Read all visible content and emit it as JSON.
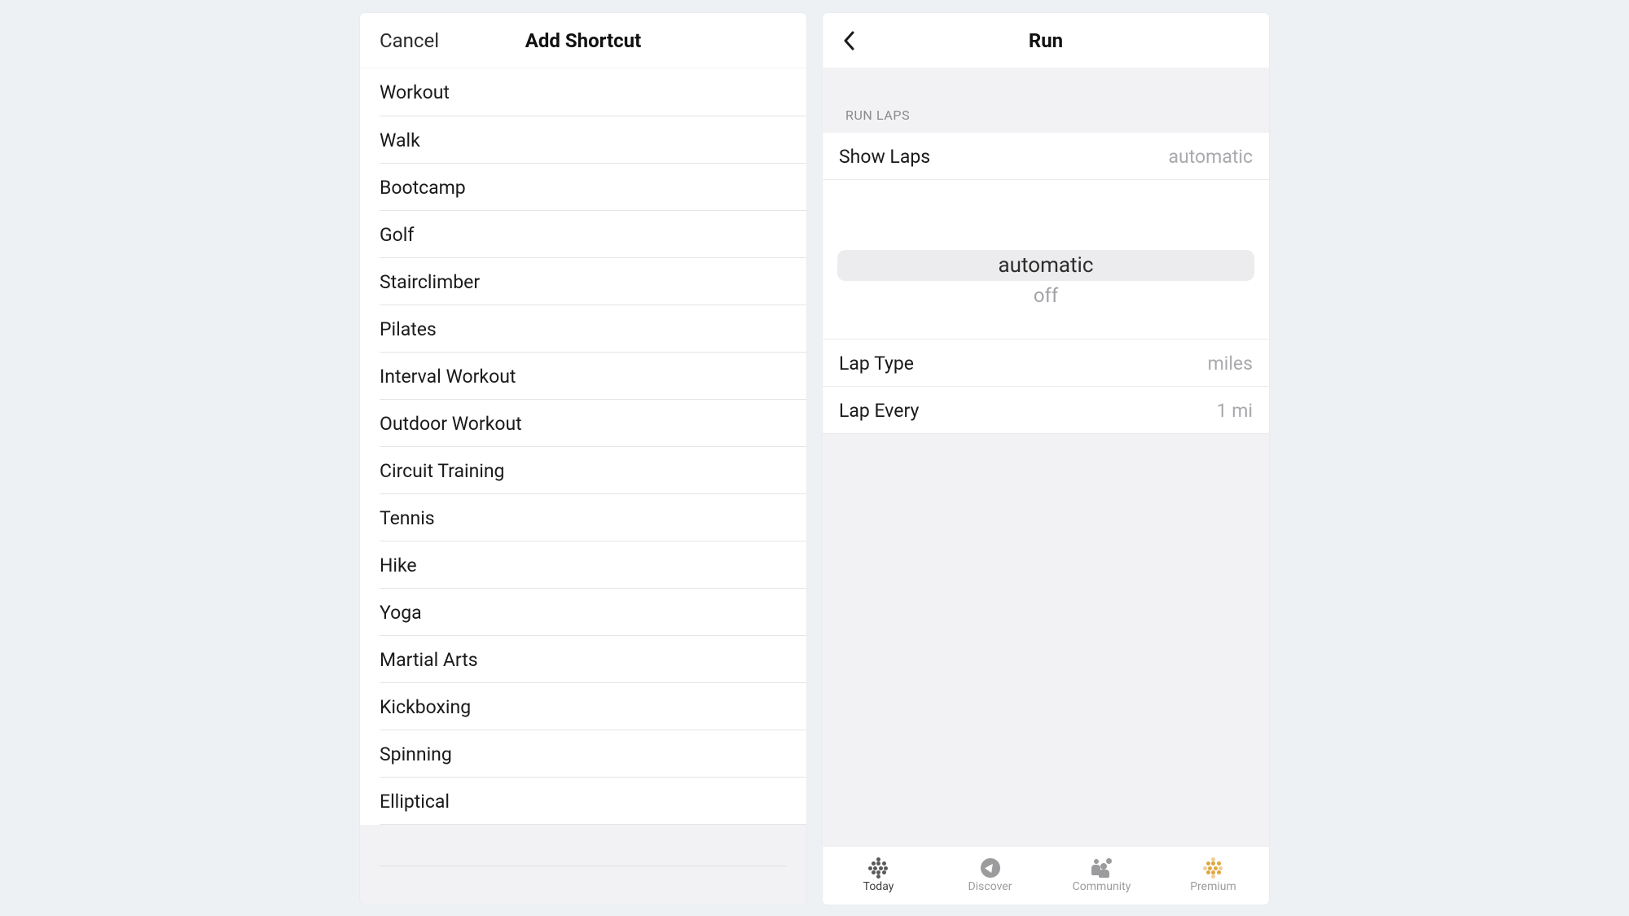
{
  "left": {
    "cancel": "Cancel",
    "title": "Add Shortcut",
    "items": [
      "Workout",
      "Walk",
      "Bootcamp",
      "Golf",
      "Stairclimber",
      "Pilates",
      "Interval Workout",
      "Outdoor Workout",
      "Circuit Training",
      "Tennis",
      "Hike",
      "Yoga",
      "Martial Arts",
      "Kickboxing",
      "Spinning",
      "Elliptical"
    ]
  },
  "right": {
    "title": "Run",
    "section_header": "RUN LAPS",
    "show_laps": {
      "label": "Show Laps",
      "value": "automatic"
    },
    "picker": {
      "selected": "automatic",
      "other": "off"
    },
    "lap_type": {
      "label": "Lap Type",
      "value": "miles"
    },
    "lap_every": {
      "label": "Lap Every",
      "value": "1 mi"
    },
    "tabs": [
      {
        "label": "Today",
        "active": true
      },
      {
        "label": "Discover",
        "active": false
      },
      {
        "label": "Community",
        "active": false
      },
      {
        "label": "Premium",
        "active": false
      }
    ]
  }
}
